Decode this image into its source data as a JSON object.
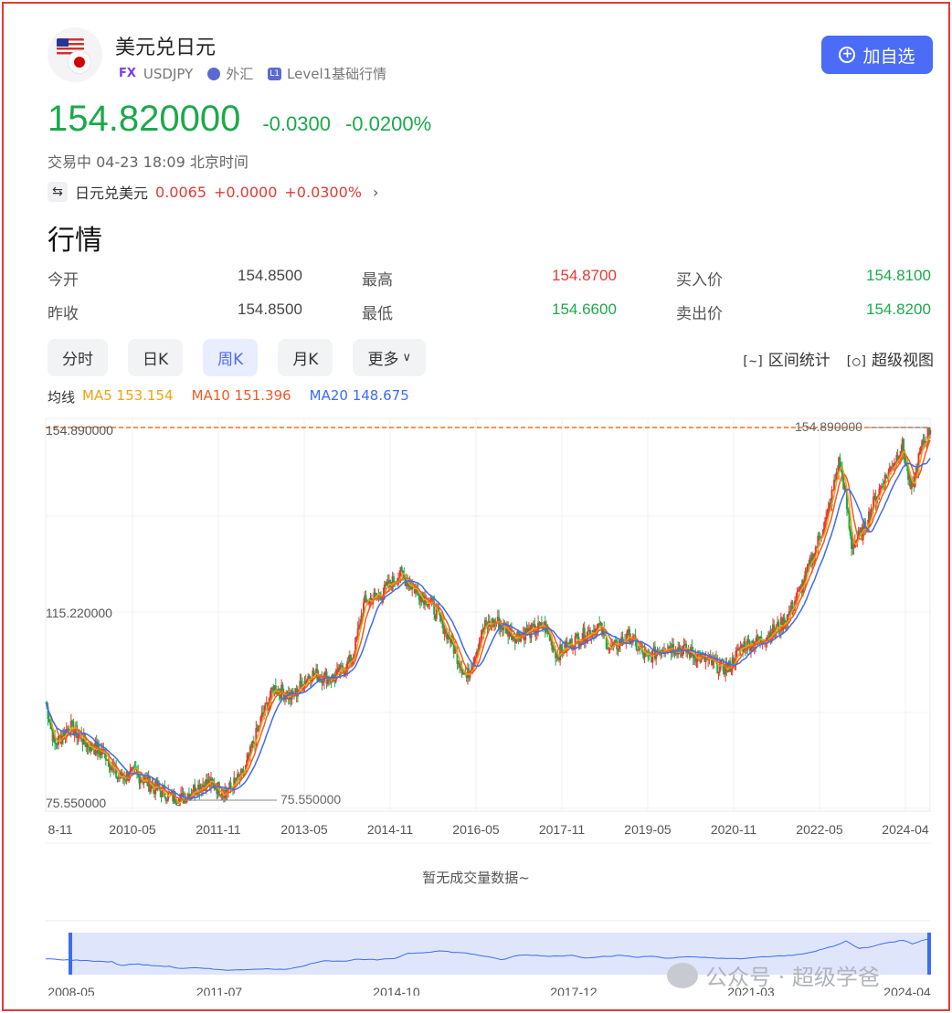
{
  "instrument": {
    "name": "美元兑日元",
    "tag": "FX",
    "symbol": "USDJPY",
    "market": "外汇",
    "level_badge": "L1",
    "level": "Level1基础行情",
    "icons": [
      "us-flag-icon",
      "jp-flag-icon",
      "globe-icon",
      "level-badge-icon"
    ]
  },
  "actions": {
    "add_watchlist": "加自选"
  },
  "price": {
    "last": "154.820000",
    "change": "-0.0300",
    "change_pct": "-0.0200%",
    "status": "交易中 04-23 18:09 北京时间",
    "color": "#1ba94c"
  },
  "related": {
    "name": "日元兑美元",
    "last": "0.0065",
    "change": "+0.0000",
    "change_pct": "+0.0300%"
  },
  "section_title": "行情",
  "quote": {
    "open_label": "今开",
    "open": "154.8500",
    "prev_close_label": "昨收",
    "prev_close": "154.8500",
    "high_label": "最高",
    "high": "154.8700",
    "low_label": "最低",
    "low": "154.6600",
    "bid_label": "买入价",
    "bid": "154.8100",
    "ask_label": "卖出价",
    "ask": "154.8200"
  },
  "tabs": [
    "分时",
    "日K",
    "周K",
    "月K",
    "更多"
  ],
  "active_tab": "周K",
  "tools": {
    "interval_stats": "区间统计",
    "super_view": "超级视图"
  },
  "ma": {
    "label": "均线",
    "ma5": "MA5 153.154",
    "ma5_color": "#f2a20f",
    "ma10": "MA10 151.396",
    "ma10_color": "#f05a28",
    "ma20": "MA20 148.675",
    "ma20_color": "#3b6cf5"
  },
  "no_volume": "暂无成交量数据~",
  "watermark": "公众号 · 超级学爸",
  "chart_data": {
    "type": "candlestick",
    "period": "weekly",
    "y_tick_labels": [
      "154.890000",
      "115.220000",
      "75.550000"
    ],
    "max_marker": "154.890000",
    "min_marker": "75.550000",
    "ylim": [
      75.55,
      154.89
    ],
    "x_tick_labels": [
      "8-11",
      "2010-05",
      "2011-11",
      "2013-05",
      "2014-11",
      "2016-05",
      "2017-11",
      "2019-05",
      "2020-11",
      "2022-05",
      "2024-04"
    ],
    "navigator_labels": [
      "2008-05",
      "2011-07",
      "2014-10",
      "2017-12",
      "2021-03",
      "2024-04"
    ],
    "up_color": "#e53935",
    "down_color": "#1ba94c",
    "series_path": [
      [
        2009.6,
        97
      ],
      [
        2009.75,
        88
      ],
      [
        2010.0,
        92
      ],
      [
        2010.3,
        88
      ],
      [
        2010.6,
        86
      ],
      [
        2010.8,
        81
      ],
      [
        2011.1,
        82
      ],
      [
        2011.4,
        79
      ],
      [
        2011.7,
        77
      ],
      [
        2011.85,
        76.5
      ],
      [
        2012.1,
        79
      ],
      [
        2012.3,
        80
      ],
      [
        2012.6,
        78
      ],
      [
        2012.9,
        82
      ],
      [
        2013.2,
        94
      ],
      [
        2013.4,
        100
      ],
      [
        2013.7,
        98
      ],
      [
        2014.0,
        103
      ],
      [
        2014.4,
        102
      ],
      [
        2014.7,
        106
      ],
      [
        2014.9,
        118
      ],
      [
        2015.2,
        120
      ],
      [
        2015.5,
        124
      ],
      [
        2015.8,
        120
      ],
      [
        2016.0,
        118
      ],
      [
        2016.3,
        111
      ],
      [
        2016.6,
        102
      ],
      [
        2016.9,
        113
      ],
      [
        2017.1,
        114
      ],
      [
        2017.4,
        111
      ],
      [
        2017.7,
        112
      ],
      [
        2017.9,
        113
      ],
      [
        2018.1,
        107
      ],
      [
        2018.4,
        110
      ],
      [
        2018.8,
        113
      ],
      [
        2019.0,
        108
      ],
      [
        2019.3,
        111
      ],
      [
        2019.6,
        106
      ],
      [
        2019.9,
        109
      ],
      [
        2020.2,
        108
      ],
      [
        2020.4,
        107
      ],
      [
        2020.7,
        105
      ],
      [
        2020.95,
        104
      ],
      [
        2021.2,
        109
      ],
      [
        2021.5,
        110
      ],
      [
        2021.9,
        114
      ],
      [
        2022.2,
        122
      ],
      [
        2022.45,
        131
      ],
      [
        2022.6,
        136
      ],
      [
        2022.8,
        148
      ],
      [
        2022.9,
        141
      ],
      [
        2023.0,
        130
      ],
      [
        2023.2,
        133
      ],
      [
        2023.4,
        140
      ],
      [
        2023.6,
        145
      ],
      [
        2023.85,
        151
      ],
      [
        2024.0,
        141
      ],
      [
        2024.15,
        150
      ],
      [
        2024.31,
        154.8
      ]
    ]
  }
}
